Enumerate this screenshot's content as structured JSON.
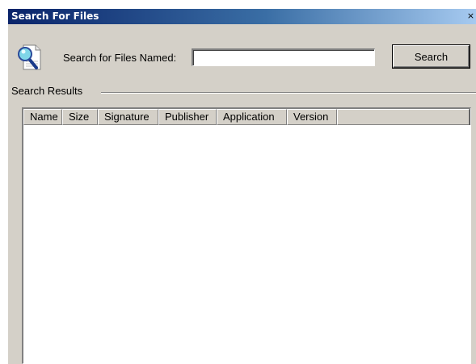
{
  "window": {
    "title": "Search For Files",
    "close_glyph": "×"
  },
  "search": {
    "icon": "document-magnifier-icon",
    "label": "Search for Files Named:",
    "value": "",
    "placeholder": "",
    "button_label": "Search"
  },
  "results": {
    "group_label": "Search Results",
    "columns": [
      {
        "label": "Name"
      },
      {
        "label": "Size"
      },
      {
        "label": "Signature"
      },
      {
        "label": "Publisher"
      },
      {
        "label": "Application"
      },
      {
        "label": "Version"
      }
    ],
    "rows": []
  },
  "colors": {
    "title_start": "#0a246a",
    "title_end": "#a6caf0",
    "face": "#d4d0c8"
  }
}
